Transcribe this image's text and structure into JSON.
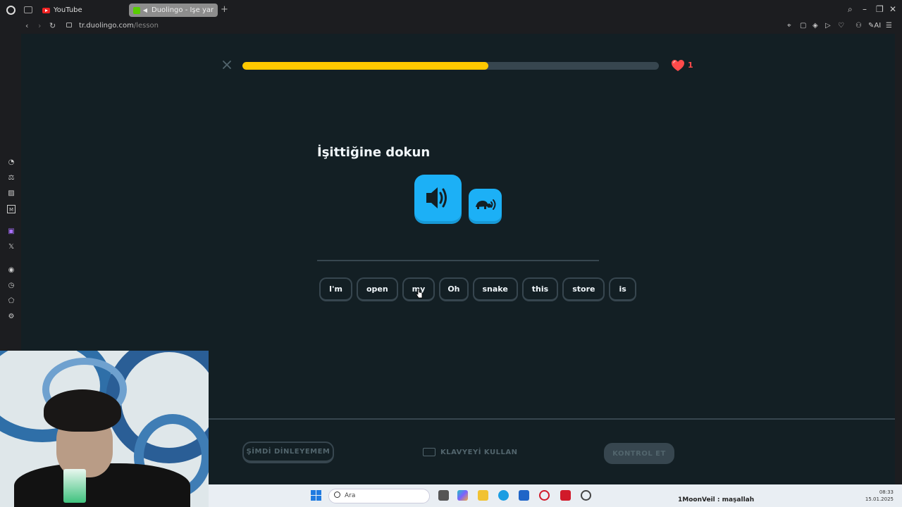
{
  "browser": {
    "tabs": [
      {
        "label": "YouTube",
        "icon": "youtube-icon"
      },
      {
        "label": "Duolingo - İşe yarayan",
        "icon": "sound-playing-icon"
      }
    ],
    "url_host": "tr.duolingo.com",
    "url_path": "/lesson"
  },
  "lesson": {
    "progress_fraction": 0.59,
    "hearts": "1",
    "prompt": "İşittiğine dokun",
    "word_bank": [
      "I'm",
      "open",
      "my",
      "Oh",
      "snake",
      "this",
      "store",
      "is"
    ]
  },
  "footer": {
    "cant_listen": "ŞİMDİ DİNLEYEMEM",
    "use_keyboard": "KLAVYEYİ KULLAN",
    "check": "KONTROL ET"
  },
  "taskbar": {
    "search_placeholder": "Ara",
    "chat_text": "1MoonVeil : maşallah",
    "time": "08:33",
    "date": "15.01.2025"
  },
  "colors": {
    "background": "#131f24",
    "progress": "#ffc800",
    "track": "#37464f",
    "speaker": "#1cb0f6",
    "heart": "#ff4b4b"
  }
}
